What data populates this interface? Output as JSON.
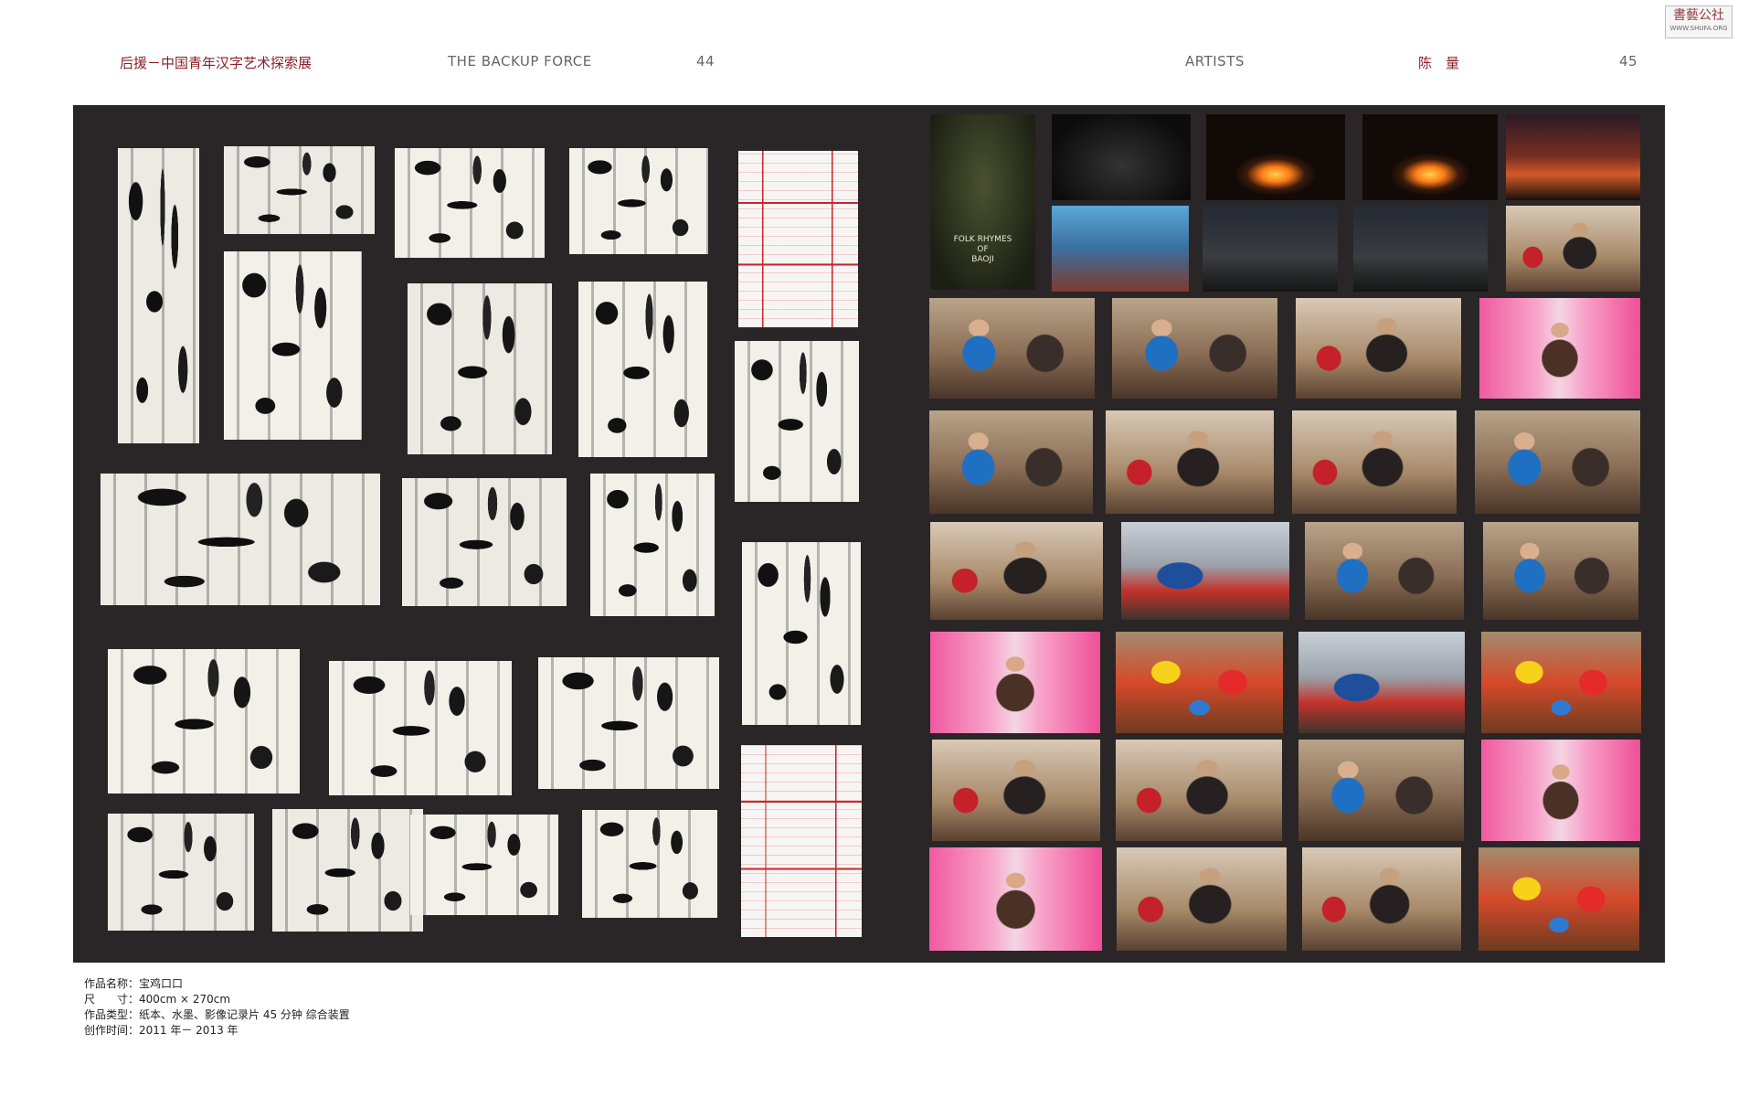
{
  "header": {
    "left_title": "后援－中国青年汉字艺术探索展",
    "left_subtitle": "THE BACKUP FORCE",
    "left_page": "44",
    "right_label": "ARTISTS",
    "right_artist": "陈　量",
    "right_page": "45"
  },
  "logo": {
    "title": "書藝公社",
    "url": "WWW.SHUFA.ORG"
  },
  "poster": {
    "line1": "FOLK RHYMES",
    "line2": "OF",
    "line3": "BAOJI"
  },
  "caption": {
    "line1": "作品名称：宝鸡口口",
    "line2": "尺　　寸：400cm × 270cm",
    "line3": "作品类型：纸本、水墨、影像记录片 45 分钟 综合装置",
    "line4": "创作时间：2011 年－ 2013 年"
  },
  "colors": {
    "title_red": "#8a1f28",
    "board": "#2a2627"
  }
}
